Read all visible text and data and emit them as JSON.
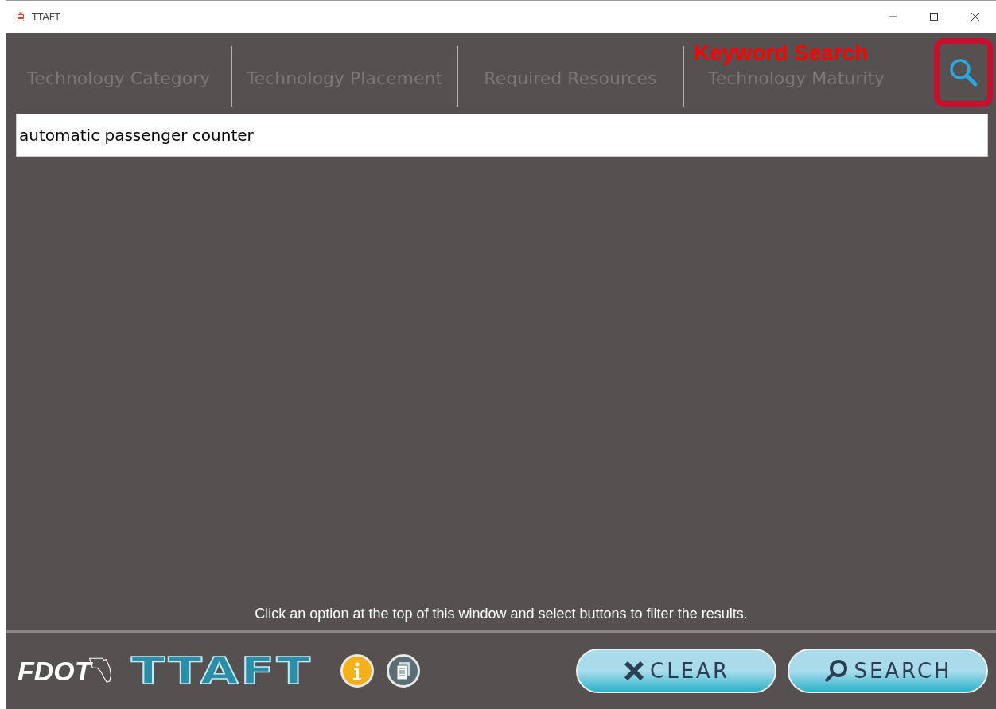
{
  "window": {
    "title": "TTAFT"
  },
  "tabs": [
    {
      "label": "Technology Category",
      "selected": false
    },
    {
      "label": "Technology Placement",
      "selected": false
    },
    {
      "label": "Required Resources",
      "selected": false
    },
    {
      "label": "Technology Maturity",
      "selected": false
    }
  ],
  "keyword_search_tab": {
    "selected": true
  },
  "annotation": {
    "label": "Keyword Search"
  },
  "search": {
    "value": "automatic passenger counter"
  },
  "hint": "Click an option at the top of this window and select buttons to filter the results.",
  "footer": {
    "agency_logo": "FDOT",
    "app_logo": "TTAFT",
    "buttons": [
      {
        "kind": "clear",
        "label": "CLEAR"
      },
      {
        "kind": "search",
        "label": "SEARCH"
      }
    ]
  }
}
